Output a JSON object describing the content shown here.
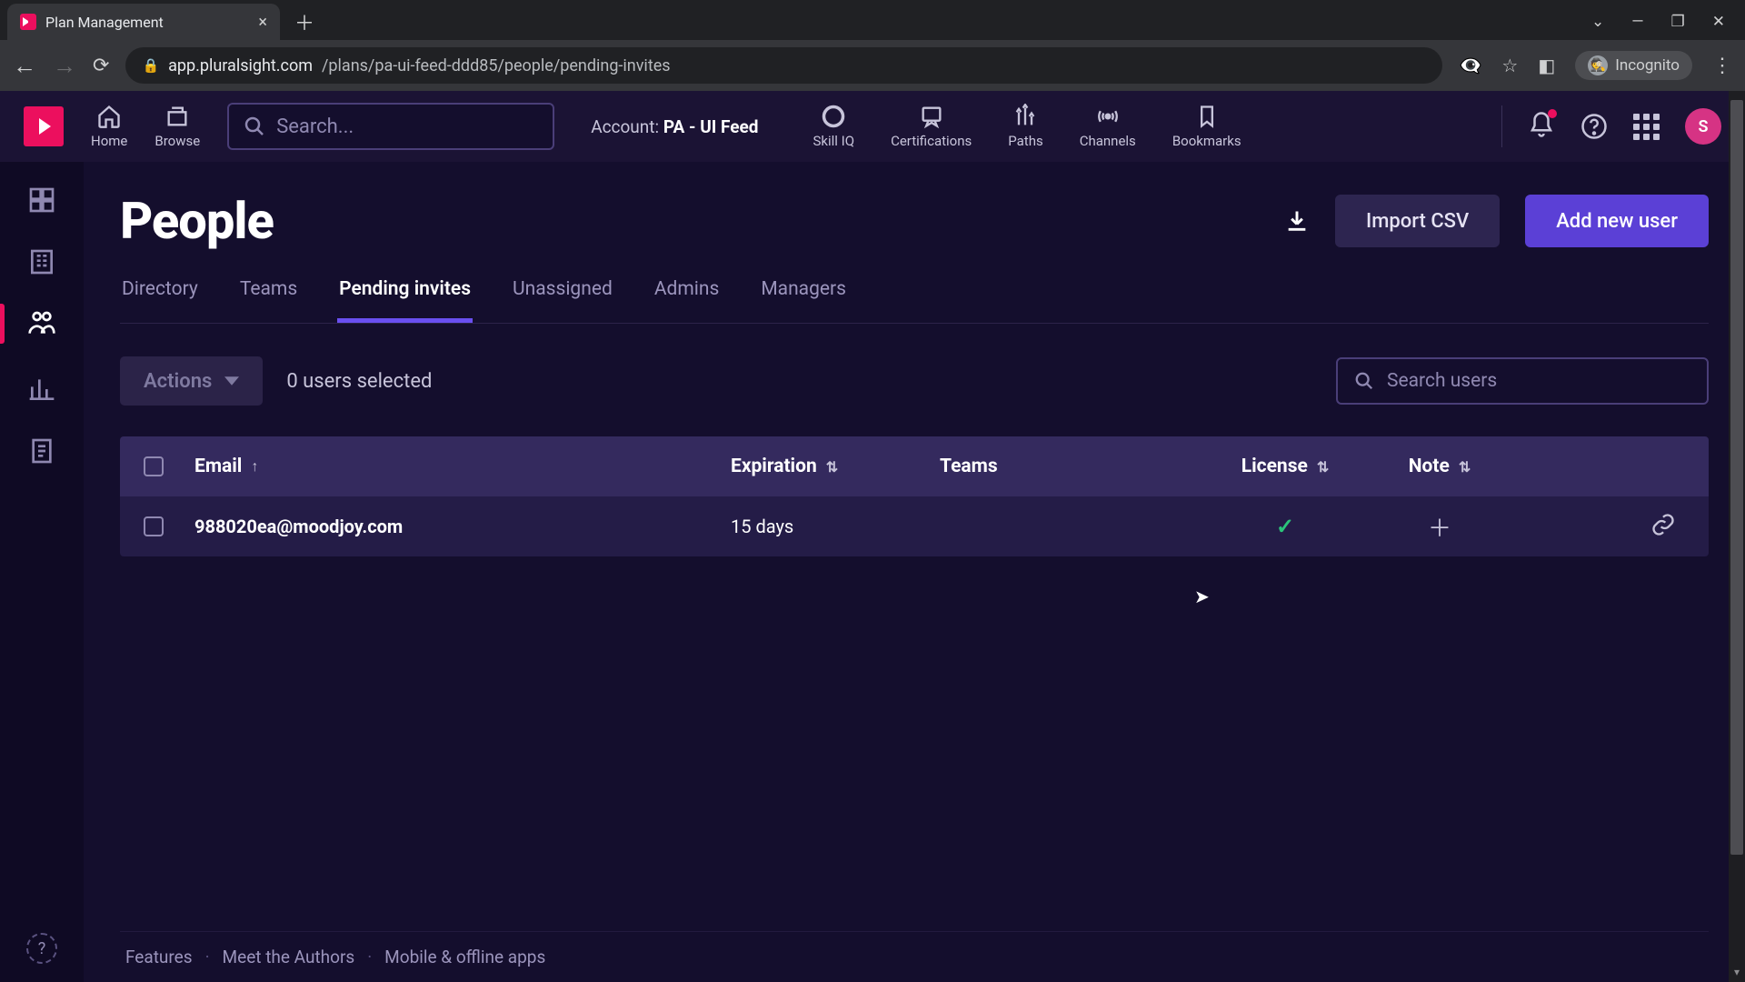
{
  "browser": {
    "tab_title": "Plan Management",
    "url_host": "app.pluralsight.com",
    "url_path": "/plans/pa-ui-feed-ddd85/people/pending-invites",
    "incognito_label": "Incognito"
  },
  "header": {
    "nav": {
      "home": "Home",
      "browse": "Browse"
    },
    "search_placeholder": "Search...",
    "account_label": "Account:",
    "account_name": "PA - UI Feed",
    "midnav": {
      "skilliq": "Skill IQ",
      "certifications": "Certifications",
      "paths": "Paths",
      "channels": "Channels",
      "bookmarks": "Bookmarks"
    },
    "avatar_initial": "S"
  },
  "page": {
    "title": "People",
    "import_csv": "Import CSV",
    "add_user": "Add new user",
    "tabs": [
      "Directory",
      "Teams",
      "Pending invites",
      "Unassigned",
      "Admins",
      "Managers"
    ],
    "active_tab_index": 2,
    "actions_label": "Actions",
    "users_selected": "0 users selected",
    "search_users_placeholder": "Search users",
    "columns": {
      "email": "Email",
      "expiration": "Expiration",
      "teams": "Teams",
      "license": "License",
      "note": "Note"
    },
    "rows": [
      {
        "email": "988020ea@moodjoy.com",
        "expiration": "15 days",
        "teams": "",
        "license": "check",
        "note": "plus"
      }
    ]
  },
  "footer": {
    "links": [
      "Features",
      "Meet the Authors",
      "Mobile & offline apps"
    ]
  }
}
